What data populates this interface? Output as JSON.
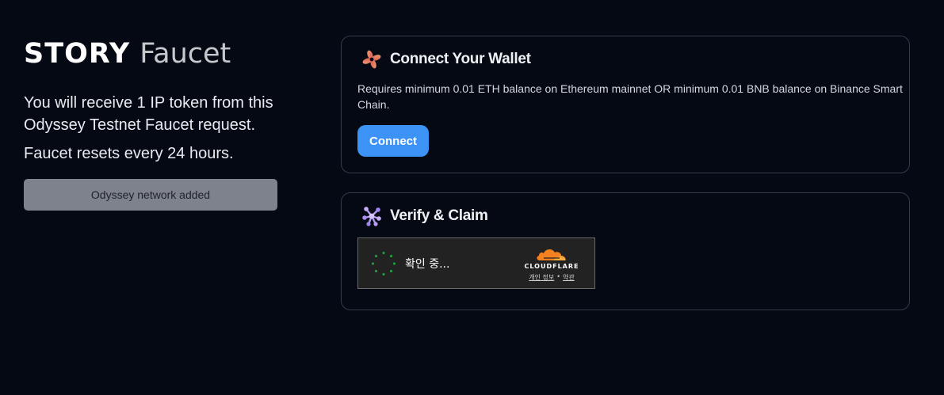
{
  "brand": {
    "story": "STORY",
    "faucet": "Faucet"
  },
  "intro": {
    "receive_text": "You will receive 1 IP token from this Odyssey Testnet Faucet request.",
    "resets_text": "Faucet resets every 24 hours.",
    "network_button": "Odyssey network added"
  },
  "connect_card": {
    "icon": "story-flower-icon",
    "title": "Connect Your Wallet",
    "description": "Requires minimum 0.01 ETH balance on Ethereum mainnet OR minimum 0.01 BNB balance on Binance Smart Chain.",
    "button": "Connect",
    "button_color": "#3d93f5"
  },
  "verify_card": {
    "icon": "story-molecule-icon",
    "title": "Verify & Claim",
    "captcha": {
      "status": "확인 중...",
      "brand": "CLOUDFLARE",
      "privacy_link": "개인 정보",
      "separator": "•",
      "terms_link": "약관",
      "accent_color": "#f48120"
    }
  },
  "colors": {
    "background": "#050914",
    "card_border": "#343a4a",
    "network_button_bg": "#7e828c"
  }
}
